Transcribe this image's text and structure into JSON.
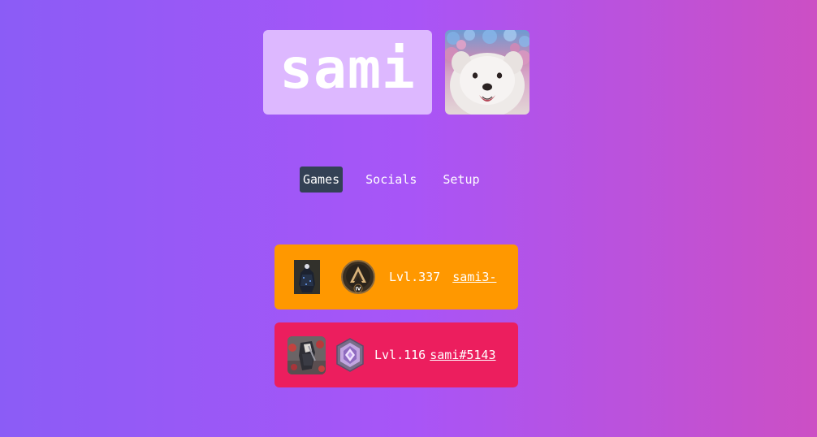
{
  "profile": {
    "name": "sami",
    "avatar_icon": "samoyed-dog-photo"
  },
  "nav": {
    "items": [
      {
        "label": "Games",
        "active": true
      },
      {
        "label": "Socials",
        "active": false
      },
      {
        "label": "Setup",
        "active": false
      }
    ]
  },
  "games": [
    {
      "game": "apex-legends",
      "character_icon": "apex-legend-character-icon",
      "rank_icon": "apex-rank-badge-icon",
      "rank_label": "IV",
      "level": "Lvl.337",
      "handle": "sami3-",
      "color": "#ff9800"
    },
    {
      "game": "valorant",
      "character_icon": "valorant-agent-icon",
      "rank_icon": "valorant-rank-badge-icon",
      "level": "Lvl.116",
      "handle": "sami#5143",
      "color": "#ec1e5e"
    }
  ],
  "colors": {
    "gradient_start": "#8b5cf6",
    "gradient_end": "#cc4fc4",
    "name_box": "#ddb8ff",
    "nav_active": "#334155"
  }
}
